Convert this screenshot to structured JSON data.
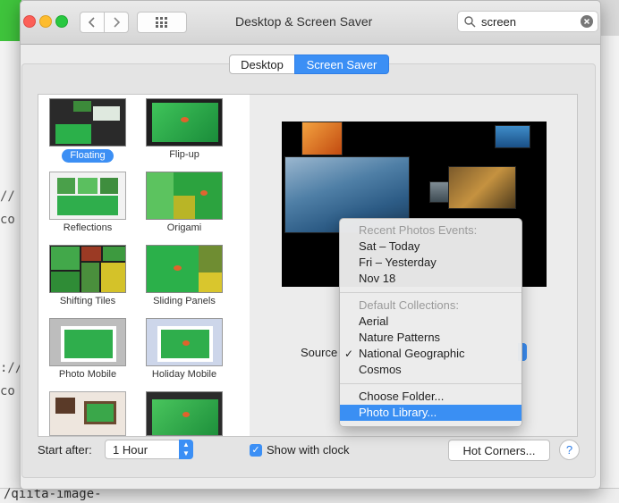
{
  "window": {
    "title": "Desktop & Screen Saver",
    "search_value": "screen"
  },
  "tabs": [
    {
      "label": "Desktop",
      "selected": false
    },
    {
      "label": "Screen Saver",
      "selected": true
    }
  ],
  "screen_savers": [
    {
      "label": "Floating",
      "selected": true
    },
    {
      "label": "Flip-up",
      "selected": false
    },
    {
      "label": "Reflections",
      "selected": false
    },
    {
      "label": "Origami",
      "selected": false
    },
    {
      "label": "Shifting Tiles",
      "selected": false
    },
    {
      "label": "Sliding Panels",
      "selected": false
    },
    {
      "label": "Photo Mobile",
      "selected": false
    },
    {
      "label": "Holiday Mobile",
      "selected": false
    }
  ],
  "preview": {
    "source_label": "Source"
  },
  "source_menu": {
    "recent_header": "Recent Photos Events:",
    "recent_items": [
      "Sat – Today",
      "Fri – Yesterday",
      "Nov 18"
    ],
    "collections_header": "Default Collections:",
    "collections": [
      "Aerial",
      "Nature Patterns",
      "National Geographic",
      "Cosmos"
    ],
    "checked_item": "National Geographic",
    "choose_folder": "Choose Folder...",
    "photo_library": "Photo Library..."
  },
  "bottom": {
    "start_after_label": "Start after:",
    "start_after_value": "1 Hour",
    "show_clock_label": "Show with clock",
    "show_clock_checked": true,
    "hot_corners_label": "Hot Corners...",
    "help_label": "?"
  },
  "background": {
    "left_snippets": [
      "//",
      "co",
      "://",
      "co"
    ],
    "bottom_text": "/qiita-image-"
  },
  "colors": {
    "accent": "#3b8ff5",
    "close": "#fc5f57",
    "minimize": "#fdbc2e",
    "zoom": "#28c840"
  }
}
